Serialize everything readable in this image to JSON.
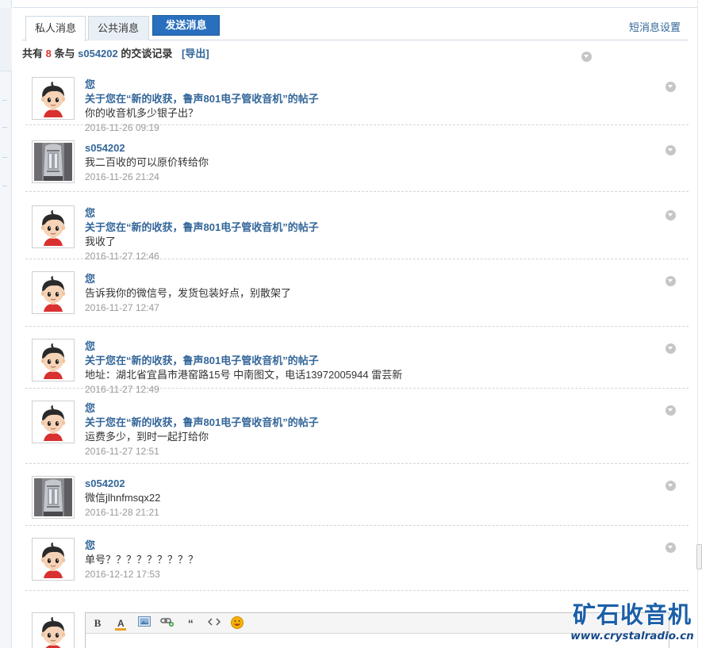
{
  "tabs": {
    "private": "私人消息",
    "public": "公共消息",
    "send": "发送消息",
    "settings": "短消息设置"
  },
  "summary": {
    "prefix": "共有",
    "count": "8",
    "mid": "条与",
    "username": "s054202",
    "suffix": "的交谈记录",
    "export": "[导出]"
  },
  "messages": [
    {
      "sender": "您",
      "subject": "关于您在“新的收获，鲁声801电子管收音机”的帖子",
      "body": "你的收音机多少银子出？",
      "time": "2016-11-26 09:19",
      "avatar": "cartoon-boy"
    },
    {
      "sender": "s054202",
      "subject": "",
      "body": "我二百收的可以原价转给你",
      "time": "2016-11-26 21:24",
      "avatar": "vacuum-tube-photo"
    },
    {
      "sender": "您",
      "subject": "关于您在“新的收获，鲁声801电子管收音机”的帖子",
      "body": "我收了",
      "time": "2016-11-27 12:46",
      "avatar": "cartoon-boy"
    },
    {
      "sender": "您",
      "subject": "",
      "body": "告诉我你的微信号，发货包装好点，别散架了",
      "time": "2016-11-27 12:47",
      "avatar": "cartoon-boy"
    },
    {
      "sender": "您",
      "subject": "关于您在“新的收获，鲁声801电子管收音机”的帖子",
      "body": "地址：湖北省宜昌市港窑路15号 中南图文，电话13972005944  雷芸新",
      "time": "2016-11-27 12:49",
      "avatar": "cartoon-boy"
    },
    {
      "sender": "您",
      "subject": "关于您在“新的收获，鲁声801电子管收音机”的帖子",
      "body": "运费多少，到时一起打给你",
      "time": "2016-11-27 12:51",
      "avatar": "cartoon-boy"
    },
    {
      "sender": "s054202",
      "subject": "",
      "body": "微信jlhnfmsqx22",
      "time": "2016-11-28 21:21",
      "avatar": "vacuum-tube-photo"
    },
    {
      "sender": "您",
      "subject": "",
      "body": "单号？？？？？？？？？",
      "time": "2016-12-12 17:53",
      "avatar": "cartoon-boy"
    }
  ],
  "editor": {
    "tools": [
      "B",
      "A",
      "image",
      "link",
      "“",
      "<>",
      "emoji"
    ]
  },
  "watermark": {
    "title": "矿石收音机",
    "url": "www.crystalradio.cn"
  },
  "colors": {
    "link": "#336699",
    "count": "#dd3333",
    "send_button": "#2a6fbd",
    "timestamp": "#999999"
  }
}
